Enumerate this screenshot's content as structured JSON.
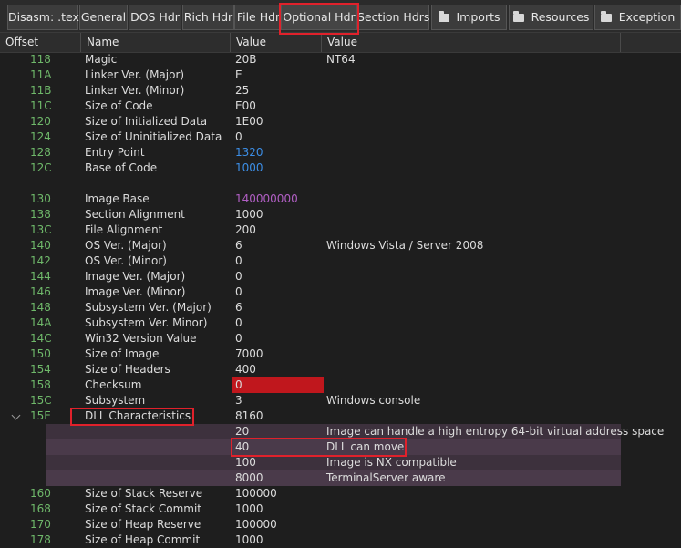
{
  "tabs": [
    {
      "label": "Disasm: .text",
      "folder": false
    },
    {
      "label": "General",
      "folder": false
    },
    {
      "label": "DOS Hdr",
      "folder": false
    },
    {
      "label": "Rich Hdr",
      "folder": false
    },
    {
      "label": "File Hdr",
      "folder": false
    },
    {
      "label": "Optional Hdr",
      "folder": false,
      "active": true
    },
    {
      "label": "Section Hdrs",
      "folder": false
    },
    {
      "label": "Imports",
      "folder": true
    },
    {
      "label": "Resources",
      "folder": true
    },
    {
      "label": "Exception",
      "folder": true
    }
  ],
  "columns": [
    "Offset",
    "Name",
    "Value",
    "Value"
  ],
  "rows": [
    {
      "offset": "118",
      "name": "Magic",
      "value": "20B",
      "desc": "NT64"
    },
    {
      "offset": "11A",
      "name": "Linker Ver. (Major)",
      "value": "E",
      "desc": ""
    },
    {
      "offset": "11B",
      "name": "Linker Ver. (Minor)",
      "value": "25",
      "desc": ""
    },
    {
      "offset": "11C",
      "name": "Size of Code",
      "value": "E00",
      "desc": ""
    },
    {
      "offset": "120",
      "name": "Size of Initialized Data",
      "value": "1E00",
      "desc": ""
    },
    {
      "offset": "124",
      "name": "Size of Uninitialized Data",
      "value": "0",
      "desc": ""
    },
    {
      "offset": "128",
      "name": "Entry Point",
      "value": "1320",
      "desc": "",
      "value_color": "#3c8ee6"
    },
    {
      "offset": "12C",
      "name": "Base of Code",
      "value": "1000",
      "desc": "",
      "value_color": "#3c8ee6"
    },
    {
      "offset": "",
      "name": "",
      "value": "",
      "desc": ""
    },
    {
      "offset": "130",
      "name": "Image Base",
      "value": "140000000",
      "desc": "",
      "value_color": "#b15fc4"
    },
    {
      "offset": "138",
      "name": "Section Alignment",
      "value": "1000",
      "desc": ""
    },
    {
      "offset": "13C",
      "name": "File Alignment",
      "value": "200",
      "desc": ""
    },
    {
      "offset": "140",
      "name": "OS Ver. (Major)",
      "value": "6",
      "desc": "Windows Vista / Server 2008"
    },
    {
      "offset": "142",
      "name": "OS Ver. (Minor)",
      "value": "0",
      "desc": ""
    },
    {
      "offset": "144",
      "name": "Image Ver. (Major)",
      "value": "0",
      "desc": ""
    },
    {
      "offset": "146",
      "name": "Image Ver. (Minor)",
      "value": "0",
      "desc": ""
    },
    {
      "offset": "148",
      "name": "Subsystem Ver. (Major)",
      "value": "6",
      "desc": ""
    },
    {
      "offset": "14A",
      "name": "Subsystem Ver. Minor)",
      "value": "0",
      "desc": ""
    },
    {
      "offset": "14C",
      "name": "Win32 Version Value",
      "value": "0",
      "desc": ""
    },
    {
      "offset": "150",
      "name": "Size of Image",
      "value": "7000",
      "desc": ""
    },
    {
      "offset": "154",
      "name": "Size of Headers",
      "value": "400",
      "desc": ""
    },
    {
      "offset": "158",
      "name": "Checksum",
      "value": "0",
      "desc": "",
      "checksum": true
    },
    {
      "offset": "15C",
      "name": "Subsystem",
      "value": "3",
      "desc": "Windows console"
    },
    {
      "offset": "15E",
      "name": "DLL Characteristics",
      "value": "8160",
      "desc": "",
      "expanded": true,
      "highlight_name": true
    }
  ],
  "dll_flags": [
    {
      "value": "20",
      "desc": "Image can handle a high entropy 64-bit virtual address space"
    },
    {
      "value": "40",
      "desc": "DLL can move",
      "highlight": true
    },
    {
      "value": "100",
      "desc": "Image is NX compatible"
    },
    {
      "value": "8000",
      "desc": "TerminalServer aware"
    }
  ],
  "rows_after": [
    {
      "offset": "160",
      "name": "Size of Stack Reserve",
      "value": "100000",
      "desc": ""
    },
    {
      "offset": "168",
      "name": "Size of Stack Commit",
      "value": "1000",
      "desc": ""
    },
    {
      "offset": "170",
      "name": "Size of Heap Reserve",
      "value": "100000",
      "desc": ""
    },
    {
      "offset": "178",
      "name": "Size of Heap Commit",
      "value": "1000",
      "desc": ""
    }
  ],
  "colors": {
    "offset": "#6fb86a",
    "address_blue": "#3c8ee6",
    "image_base_purple": "#b15fc4",
    "checksum_bg": "#c0171d",
    "highlight_border": "#e0212b",
    "flag_band_even": "#4a3a4a",
    "flag_band_odd": "#3d313d"
  }
}
